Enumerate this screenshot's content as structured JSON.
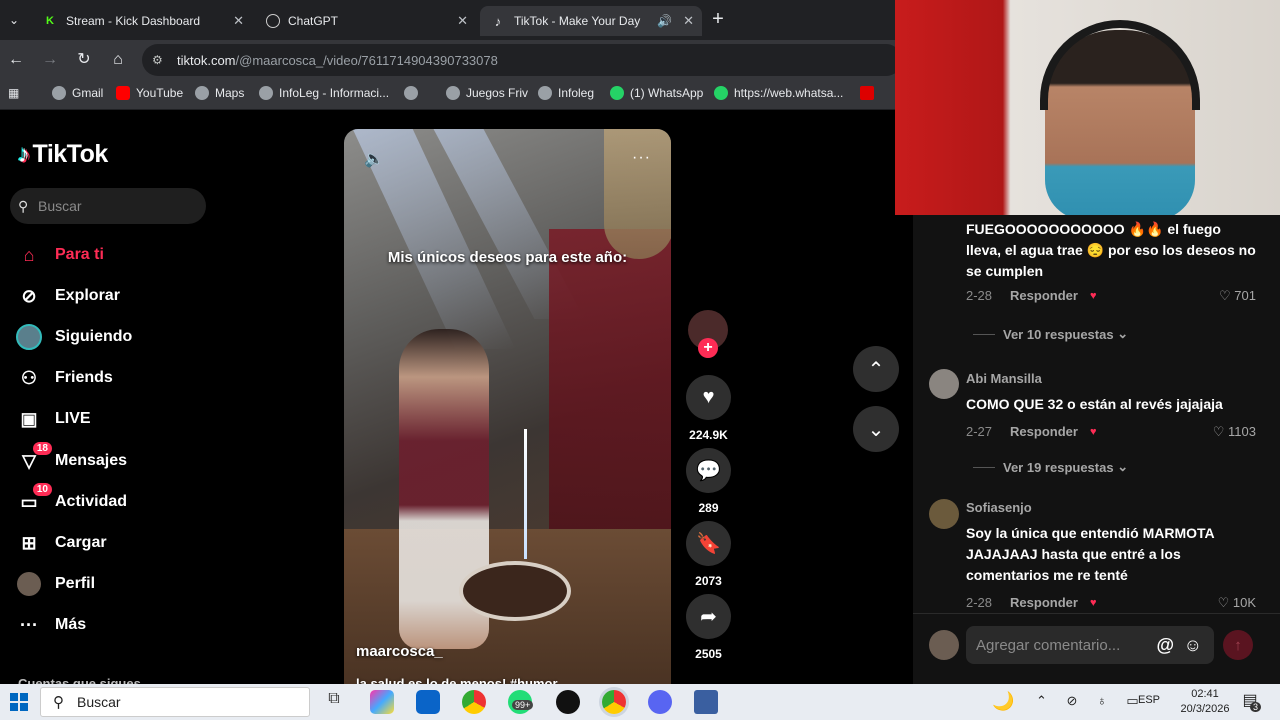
{
  "browser": {
    "tabs": [
      {
        "title": "Stream - Kick Dashboard",
        "icon": "kick-icon",
        "color": "#53fc18"
      },
      {
        "title": "ChatGPT",
        "icon": "chatgpt-icon",
        "color": "#ffffff"
      },
      {
        "title": "TikTok - Make Your Day",
        "icon": "tiktok-icon",
        "color": "#ffffff"
      }
    ],
    "new_tab": "+",
    "url_main": "tiktok.com",
    "url_path": "/@maarcosca_/video/7611714904390733078",
    "bookmarks": [
      "Gmail",
      "YouTube",
      "Maps",
      "InfoLeg - Informaci...",
      "Juegos Friv",
      "Infoleg",
      "(1) WhatsApp",
      "https://web.whatsa..."
    ]
  },
  "tiktok": {
    "logo": "TikTok",
    "search_placeholder": "Buscar",
    "nav": [
      {
        "label": "Para ti",
        "icon": "home-icon"
      },
      {
        "label": "Explorar",
        "icon": "compass-icon"
      },
      {
        "label": "Siguiendo",
        "icon": "following-avatar-icon"
      },
      {
        "label": "Friends",
        "icon": "friends-icon"
      },
      {
        "label": "LIVE",
        "icon": "live-icon"
      },
      {
        "label": "Mensajes",
        "icon": "messages-icon",
        "badge": "18"
      },
      {
        "label": "Actividad",
        "icon": "activity-icon",
        "badge": "10"
      },
      {
        "label": "Cargar",
        "icon": "upload-icon"
      },
      {
        "label": "Perfil",
        "icon": "profile-avatar-icon"
      },
      {
        "label": "Más",
        "icon": "more-icon"
      }
    ],
    "following_section": "Cuentas que sigues",
    "accent": "#fe2c55"
  },
  "video": {
    "caption_overlay": "Mis únicos deseos para este año:",
    "author": "maarcosca_",
    "description": "la salud es lo de menos! #humor",
    "actions": {
      "likes": "224.9K",
      "comments": "289",
      "saves": "2073",
      "shares": "2505"
    }
  },
  "comments": [
    {
      "name": "",
      "text": "FUEGOOOOOOOOOOO 🔥🔥 el fuego lleva, el agua trae 😔 por eso los deseos no se cumplen",
      "date": "2-28",
      "reply": "Responder",
      "likes": "701",
      "more": "Ver 10 respuestas"
    },
    {
      "name": "Abi Mansilla",
      "text": "COMO QUE 32 o están al revés jajajaja",
      "date": "2-27",
      "reply": "Responder",
      "likes": "1103",
      "more": "Ver 19 respuestas"
    },
    {
      "name": "Sofiasenjo",
      "text": "Soy la única que entendió MARMOTA JAJAJAAJ hasta que entré a los comentarios me re tenté",
      "date": "2-28",
      "reply": "Responder",
      "likes": "10K",
      "more": ""
    }
  ],
  "comment_input": {
    "placeholder": "Agregar comentario...",
    "at": "@"
  },
  "taskbar": {
    "search": "Buscar",
    "mail_badge": "99+",
    "lang": "ESP",
    "time": "02:41",
    "date": "20/3/2026",
    "notif_count": "3"
  }
}
